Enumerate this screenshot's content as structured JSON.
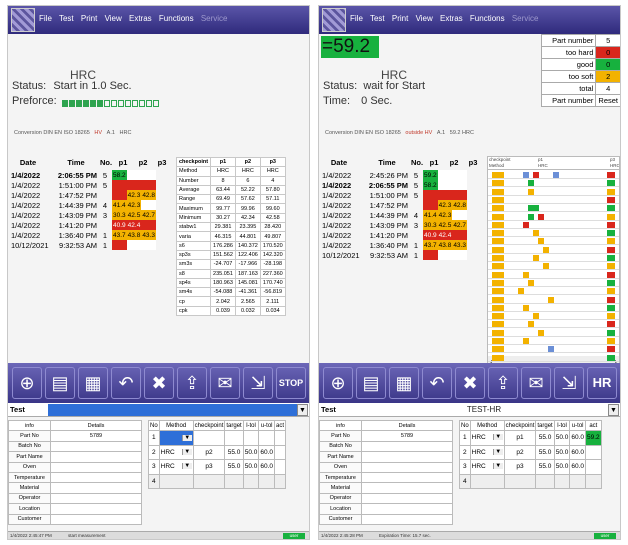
{
  "menu": [
    "File",
    "Test",
    "Print",
    "View",
    "Extras",
    "Functions"
  ],
  "menu_disabled": "Service",
  "left": {
    "title": "HRC",
    "status_label": "Status:",
    "status_value": "Start in 1.0  Sec.",
    "preforce_label": "Preforce:",
    "preforce_progress": 0.4,
    "conversion": [
      "Conversion DIN EN ISO 18265",
      "HV",
      "A.1",
      "HRC"
    ],
    "results_header": [
      "Date",
      "Time",
      "No.",
      "p1",
      "p2",
      "p3"
    ],
    "results": [
      {
        "date": "1/4/2022",
        "time": "2:06:55 PM",
        "no": "5",
        "p": [
          [
            "58.2",
            "g"
          ],
          [
            "",
            "w"
          ],
          [
            "",
            "w"
          ]
        ],
        "bold": true
      },
      {
        "date": "1/4/2022",
        "time": "1:51:00 PM",
        "no": "5",
        "p": [
          [
            "",
            "r"
          ],
          [
            "",
            "r"
          ],
          [
            "",
            "r"
          ]
        ]
      },
      {
        "date": "1/4/2022",
        "time": "1:47:52 PM",
        "no": "",
        "p": [
          [
            "",
            "r"
          ],
          [
            "42.3",
            "y"
          ],
          [
            "42.8",
            "y"
          ]
        ]
      },
      {
        "date": "1/4/2022",
        "time": "1:44:39 PM",
        "no": "4",
        "p": [
          [
            "41.4",
            "y"
          ],
          [
            "42.3",
            "y"
          ],
          [
            "",
            "w"
          ]
        ]
      },
      {
        "date": "1/4/2022",
        "time": "1:43:09 PM",
        "no": "3",
        "p": [
          [
            "30.3",
            "y"
          ],
          [
            "42.5",
            "y"
          ],
          [
            "42.7",
            "y"
          ]
        ]
      },
      {
        "date": "1/4/2022",
        "time": "1:41:20 PM",
        "no": "",
        "p": [
          [
            "40.9",
            "r"
          ],
          [
            "42.4",
            "r"
          ],
          [
            "",
            "r"
          ]
        ]
      },
      {
        "date": "1/4/2022",
        "time": "1:36:40 PM",
        "no": "1",
        "p": [
          [
            "43.7",
            "y"
          ],
          [
            "43.8",
            "y"
          ],
          [
            "43.3",
            "y"
          ]
        ]
      },
      {
        "date": "10/12/2021",
        "time": "9:32:53 AM",
        "no": "1",
        "p": [
          [
            "",
            "r"
          ],
          [
            "",
            "w"
          ],
          [
            "",
            "w"
          ]
        ]
      }
    ],
    "stats_header": [
      "checkpoint",
      "p1",
      "p2",
      "p3"
    ],
    "stats": [
      [
        "Method",
        "HRC",
        "HRC",
        "HRC"
      ],
      [
        "Number",
        "8",
        "6",
        "4"
      ],
      [
        "Average",
        "63.44",
        "52.22",
        "57.80"
      ],
      [
        "Range",
        "69.49",
        "57.62",
        "57.11"
      ],
      [
        "Maximum",
        "99.77",
        "99.96",
        "99.60"
      ],
      [
        "Minimum",
        "30.27",
        "42.34",
        "42.58"
      ],
      [
        "stabw1",
        "29.381",
        "23.395",
        "28.420"
      ],
      [
        "varia",
        "46.315",
        "44.801",
        "49.807"
      ],
      [
        "s6",
        "176.286",
        "140.372",
        "170.520"
      ],
      [
        "sp3s",
        "151.562",
        "122.406",
        "142.320"
      ],
      [
        "sm3s",
        "-24.707",
        "-17.966",
        "-28.198"
      ],
      [
        "s8",
        "235.051",
        "187.163",
        "227.360"
      ],
      [
        "sp4s",
        "180.963",
        "145.081",
        "170.740"
      ],
      [
        "sm4s",
        "-54.088",
        "-41.361",
        "-56.819"
      ],
      [
        "cp",
        "2.042",
        "2.565",
        "2.111"
      ],
      [
        "cpk",
        "0.039",
        "0.032",
        "0.034"
      ]
    ],
    "selector_name": "Test",
    "selector_value": "",
    "info_header": [
      "info",
      "Details"
    ],
    "info": [
      [
        "Part No",
        "5789"
      ],
      [
        "Batch No",
        ""
      ],
      [
        "Part Name",
        ""
      ],
      [
        "Oven",
        ""
      ],
      [
        "Temperature",
        ""
      ],
      [
        "Material",
        ""
      ],
      [
        "Operator",
        ""
      ],
      [
        "Location",
        ""
      ],
      [
        "Customer",
        ""
      ]
    ],
    "method_header": [
      "No",
      "Method",
      "checkpoint",
      "target",
      "l-tol",
      "u-tol",
      "act"
    ],
    "methods": [
      {
        "no": "1",
        "method": "",
        "cp": "",
        "target": "",
        "ltol": "",
        "utol": "",
        "act": ""
      },
      {
        "no": "2",
        "method": "HRC",
        "cp": "p2",
        "target": "55.0",
        "ltol": "50.0",
        "utol": "60.0",
        "act": ""
      },
      {
        "no": "3",
        "method": "HRC",
        "cp": "p3",
        "target": "55.0",
        "ltol": "50.0",
        "utol": "60.0",
        "act": ""
      },
      {
        "no": "4",
        "method": "",
        "cp": "",
        "target": "",
        "ltol": "",
        "utol": "",
        "act": ""
      }
    ],
    "statusbar": [
      "1/4/2022 2:45:47 PM",
      "start measurement"
    ],
    "statusbar_ok": "user",
    "toolbar_last": "STOP"
  },
  "right": {
    "value": "=59.2",
    "title": "HRC",
    "status_label": "Status:",
    "status_value": "wait for Start",
    "time_label": "Time:",
    "time_value": "0 Sec.",
    "part_table": [
      [
        "Part number",
        "5",
        ""
      ],
      [
        "too hard",
        "0",
        "r"
      ],
      [
        "good",
        "0",
        "g"
      ],
      [
        "too soft",
        "2",
        "y"
      ],
      [
        "total",
        "4",
        ""
      ],
      [
        "Part number",
        "Reset",
        ""
      ]
    ],
    "conversion": [
      "Conversion DIN EN ISO 18265",
      "outside HV",
      "A.1",
      "59.2 HRC"
    ],
    "results_header": [
      "Date",
      "Time",
      "No.",
      "p1",
      "p2",
      "p3"
    ],
    "results": [
      {
        "date": "1/4/2022",
        "time": "2:45:26 PM",
        "no": "5",
        "p": [
          [
            "59.2",
            "g"
          ],
          [
            "",
            "w"
          ],
          [
            "",
            "w"
          ]
        ]
      },
      {
        "date": "1/4/2022",
        "time": "2:06:55 PM",
        "no": "5",
        "p": [
          [
            "58.2",
            "g"
          ],
          [
            "",
            "w"
          ],
          [
            "",
            "w"
          ]
        ],
        "bold": true
      },
      {
        "date": "1/4/2022",
        "time": "1:51:00 PM",
        "no": "5",
        "p": [
          [
            "",
            "r"
          ],
          [
            "",
            "r"
          ],
          [
            "",
            "r"
          ]
        ]
      },
      {
        "date": "1/4/2022",
        "time": "1:47:52 PM",
        "no": "",
        "p": [
          [
            "",
            "r"
          ],
          [
            "42.3",
            "y"
          ],
          [
            "42.8",
            "y"
          ]
        ]
      },
      {
        "date": "1/4/2022",
        "time": "1:44:39 PM",
        "no": "4",
        "p": [
          [
            "41.4",
            "y"
          ],
          [
            "42.3",
            "y"
          ],
          [
            "",
            "w"
          ]
        ]
      },
      {
        "date": "1/4/2022",
        "time": "1:43:09 PM",
        "no": "3",
        "p": [
          [
            "30.3",
            "y"
          ],
          [
            "42.5",
            "y"
          ],
          [
            "42.7",
            "y"
          ]
        ]
      },
      {
        "date": "1/4/2022",
        "time": "1:41:20 PM",
        "no": "",
        "p": [
          [
            "40.9",
            "r"
          ],
          [
            "42.4",
            "r"
          ],
          [
            "",
            "r"
          ]
        ]
      },
      {
        "date": "1/4/2022",
        "time": "1:36:40 PM",
        "no": "1",
        "p": [
          [
            "43.7",
            "y"
          ],
          [
            "43.8",
            "y"
          ],
          [
            "43.3",
            "y"
          ]
        ]
      },
      {
        "date": "10/12/2021",
        "time": "9:32:53 AM",
        "no": "1",
        "p": [
          [
            "",
            "r"
          ],
          [
            "",
            "w"
          ],
          [
            "",
            "w"
          ]
        ]
      }
    ],
    "chart_labels": [
      "checkpoint",
      "p1",
      "p3",
      "Method",
      "HRC",
      "HRC"
    ],
    "selector_name": "Test",
    "selector_value": "TEST-HR",
    "info_header": [
      "info",
      "Details"
    ],
    "info": [
      [
        "Part No",
        "5789"
      ],
      [
        "Batch No",
        ""
      ],
      [
        "Part Name",
        ""
      ],
      [
        "Oven",
        ""
      ],
      [
        "Temperature",
        ""
      ],
      [
        "Material",
        ""
      ],
      [
        "Operator",
        ""
      ],
      [
        "Location",
        ""
      ],
      [
        "Customer",
        ""
      ]
    ],
    "method_header": [
      "No",
      "Method",
      "checkpoint",
      "target",
      "l-tol",
      "u-tol",
      "act"
    ],
    "methods": [
      {
        "no": "1",
        "method": "HRC",
        "cp": "p1",
        "target": "55.0",
        "ltol": "50.0",
        "utol": "60.0",
        "act": "59.2"
      },
      {
        "no": "2",
        "method": "HRC",
        "cp": "p2",
        "target": "55.0",
        "ltol": "50.0",
        "utol": "60.0",
        "act": ""
      },
      {
        "no": "3",
        "method": "HRC",
        "cp": "p3",
        "target": "55.0",
        "ltol": "50.0",
        "utol": "60.0",
        "act": ""
      },
      {
        "no": "4",
        "method": "",
        "cp": "",
        "target": "",
        "ltol": "",
        "utol": "",
        "act": ""
      }
    ],
    "statusbar": [
      "1/4/2022 2:45:28 PM",
      "Expiration Time: 15.7 sec."
    ],
    "statusbar_ok": "user",
    "toolbar_last": "HR"
  },
  "toolbar_icons": [
    "target-icon",
    "print-icon",
    "table-icon",
    "undo-icon",
    "tools-icon",
    "upload-icon",
    "mail-icon",
    "export-icon"
  ],
  "toolbar_glyphs": [
    "⊕",
    "▤",
    "▦",
    "↶",
    "✖",
    "⇪",
    "✉",
    "⇲"
  ],
  "colors": {
    "green": "#17b13e",
    "red": "#d9261c",
    "yellow": "#f3b200",
    "blue": "#2e6fd8",
    "purple": "#3a3587"
  }
}
